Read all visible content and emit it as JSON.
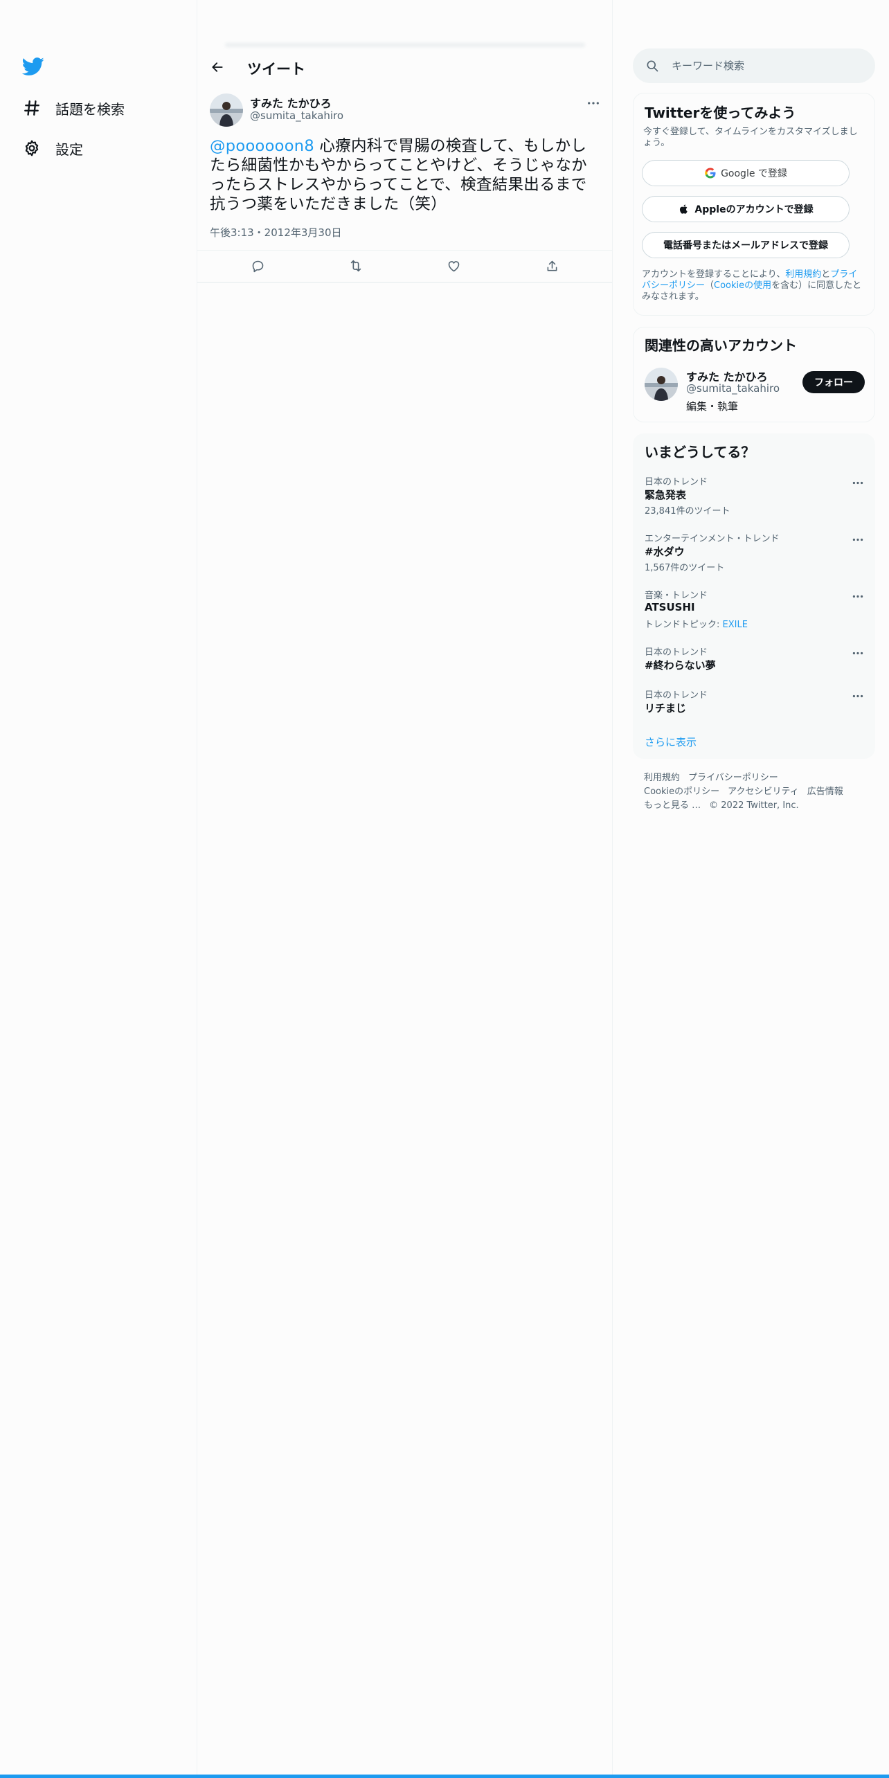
{
  "nav": {
    "explore_label": "話題を検索",
    "settings_label": "設定"
  },
  "header": {
    "title": "ツイート"
  },
  "tweet": {
    "author_name": "すみた たかひろ",
    "author_handle": "@sumita_takahiro",
    "mention": "@poooooon8",
    "body": " 心療内科で胃腸の検査して、もしかしたら細菌性かもやからってことやけど、そうじゃなかったらストレスやからってことで、検査結果出るまで抗うつ薬をいただきました（笑）",
    "timestamp": "午後3:13・2012年3月30日"
  },
  "search": {
    "placeholder": "キーワード検索"
  },
  "signup": {
    "title": "Twitterを使ってみよう",
    "description": "今すぐ登録して、タイムラインをカスタマイズしましょう。",
    "google_label": "Google で登録",
    "apple_label": "Appleのアカウントで登録",
    "phone_label": "電話番号またはメールアドレスで登録",
    "legal_prefix": "アカウントを登録することにより、",
    "legal_terms": "利用規約",
    "legal_and": "と",
    "legal_privacy": "プライバシーポリシー",
    "legal_paren_open": "（",
    "legal_cookie": "Cookieの使用",
    "legal_suffix": "を含む）に同意したとみなされます。"
  },
  "related": {
    "title": "関連性の高いアカウント",
    "name": "すみた たかひろ",
    "handle": "@sumita_takahiro",
    "bio": "編集・執筆",
    "follow_label": "フォロー"
  },
  "trends": {
    "title": "いまどうしてる？",
    "items": [
      {
        "category": "日本のトレンド",
        "name": "緊急発表",
        "count": "23,841件のツイート"
      },
      {
        "category": "エンターテインメント・トレンド",
        "name": "#水ダウ",
        "count": "1,567件のツイート"
      },
      {
        "category": "音楽・トレンド",
        "name": "ATSUSHI",
        "topic_prefix": "トレンドトピック: ",
        "topic_link": "EXILE"
      },
      {
        "category": "日本のトレンド",
        "name": "#終わらない夢"
      },
      {
        "category": "日本のトレンド",
        "name": "リチまじ"
      }
    ],
    "show_more": "さらに表示"
  },
  "footer": {
    "terms": "利用規約",
    "privacy": "プライバシーポリシー",
    "cookie": "Cookieのポリシー",
    "accessibility": "アクセシビリティ",
    "ads": "広告情報",
    "more": "もっと見る …",
    "copyright": "© 2022 Twitter, Inc."
  },
  "colors": {
    "accent": "#1d9bf0",
    "text": "#0f1419",
    "secondary": "#536471"
  }
}
